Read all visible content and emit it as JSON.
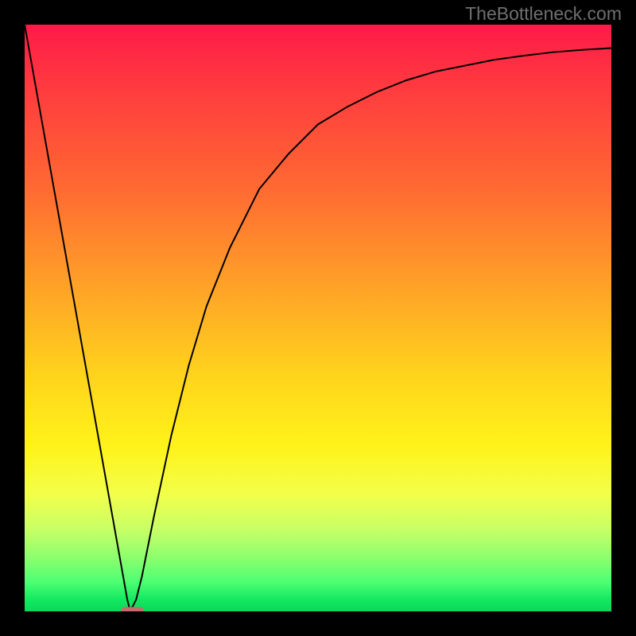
{
  "watermark": "TheBottleneck.com",
  "chart_data": {
    "type": "line",
    "title": "",
    "xlabel": "",
    "ylabel": "",
    "xlim": [
      0,
      100
    ],
    "ylim": [
      0,
      100
    ],
    "grid": false,
    "legend": false,
    "series": [
      {
        "name": "bottleneck-curve",
        "x": [
          0,
          5,
          10,
          15,
          17.5,
          18,
          19,
          20,
          22,
          25,
          28,
          31,
          35,
          40,
          45,
          50,
          55,
          60,
          65,
          70,
          75,
          80,
          85,
          90,
          95,
          100
        ],
        "y": [
          100,
          72,
          44,
          16,
          2,
          0,
          2,
          6,
          16,
          30,
          42,
          52,
          62,
          72,
          78,
          83,
          86,
          88.5,
          90.5,
          92,
          93,
          94,
          94.7,
          95.3,
          95.7,
          96
        ]
      }
    ],
    "marker": {
      "name": "minimum-marker",
      "x_range": [
        16.5,
        20.2
      ],
      "y": 0
    },
    "background": {
      "type": "gradient-vertical",
      "stops": [
        {
          "pos": 0.0,
          "color": "#ff1a48"
        },
        {
          "pos": 0.28,
          "color": "#ff6a32"
        },
        {
          "pos": 0.6,
          "color": "#ffd41c"
        },
        {
          "pos": 0.8,
          "color": "#f2ff4a"
        },
        {
          "pos": 1.0,
          "color": "#0ad85a"
        }
      ]
    }
  }
}
